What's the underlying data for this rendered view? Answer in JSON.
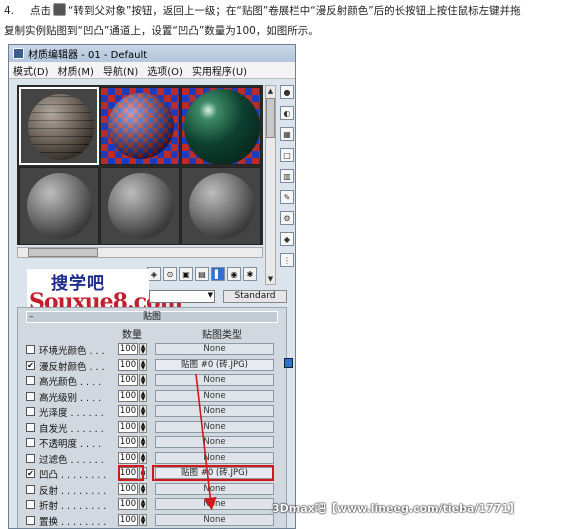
{
  "instruction": {
    "step_number": "4.",
    "line1_before_icon": "点击",
    "line1_after_icon": "“转到父对象”按钮，返回上一级；在“贴图”卷展栏中“漫反射颜色”后的长按钮上按住鼠标左键并拖",
    "line2": "复制实例贴图到“凹凸”通道上，设置“凹凸”数量为100，如图所示。"
  },
  "window": {
    "title": "材质编辑器 - 01 - Default",
    "menus": [
      "模式(D)",
      "材质(M)",
      "导航(N)",
      "选项(O)",
      "实用程序(U)"
    ]
  },
  "logo": {
    "cn": "搜学吧",
    "en": "Souxue8.com"
  },
  "name_row": {
    "standard_label": "Standard"
  },
  "maps_panel": {
    "rollout_title": "贴图",
    "header_amount": "数量",
    "header_type": "贴图类型",
    "rows": [
      {
        "label": "环境光颜色 . . .",
        "checked": false,
        "amount": "100",
        "map": "None"
      },
      {
        "label": "漫反射颜色 . . .",
        "checked": true,
        "amount": "100",
        "map": "贴图 #0 (砖.JPG)"
      },
      {
        "label": "高光颜色 . . . .",
        "checked": false,
        "amount": "100",
        "map": "None"
      },
      {
        "label": "高光级别 . . . .",
        "checked": false,
        "amount": "100",
        "map": "None"
      },
      {
        "label": "光泽度 . . . . . .",
        "checked": false,
        "amount": "100",
        "map": "None"
      },
      {
        "label": "自发光 . . . . . .",
        "checked": false,
        "amount": "100",
        "map": "None"
      },
      {
        "label": "不透明度 . . . .",
        "checked": false,
        "amount": "100",
        "map": "None"
      },
      {
        "label": "过滤色 . . . . . .",
        "checked": false,
        "amount": "100",
        "map": "None"
      },
      {
        "label": "凹凸 . . . . . . . .",
        "checked": true,
        "amount": "100",
        "map": "贴图 #0 (砖.JPG)"
      },
      {
        "label": "反射 . . . . . . . .",
        "checked": false,
        "amount": "100",
        "map": "None"
      },
      {
        "label": "折射 . . . . . . . .",
        "checked": false,
        "amount": "100",
        "map": "None"
      },
      {
        "label": "置换 . . . . . . . .",
        "checked": false,
        "amount": "100",
        "map": "None"
      }
    ]
  },
  "watermark": "3Dmax吧【www.lineeg.com/tieba/1771】",
  "colors": {
    "highlight": "#d21818",
    "accent": "#2f6fd0"
  }
}
